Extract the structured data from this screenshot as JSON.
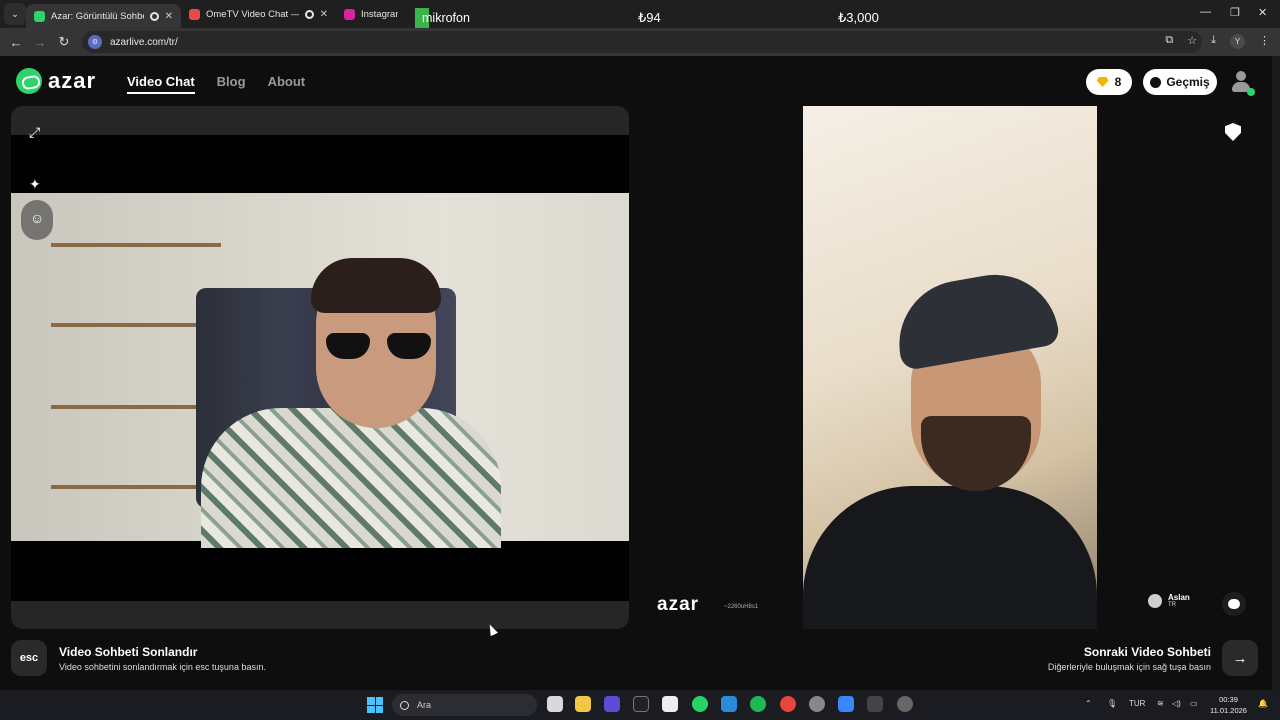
{
  "browser": {
    "tabs": [
      {
        "title": "Azar: Görüntülü Sohbet & Video",
        "color": "#2ed36a"
      },
      {
        "title": "OmeTV Video Chat — Omegle",
        "color": "#e64a4a"
      },
      {
        "title": "Instagram",
        "color": "#d6249f"
      }
    ],
    "overlay_label": "mikrofon",
    "overlay_value_1": "₺94",
    "overlay_value_2": "₺3,000",
    "url": "azarlive.com/tr/",
    "profile_letter": "Y"
  },
  "app": {
    "logo": "azar",
    "nav": {
      "video_chat": "Video Chat",
      "blog": "Blog",
      "about": "About"
    },
    "gems": "8",
    "history_label": "Geçmiş",
    "watermark": "azar",
    "watermark_id": "~2260uH8s1",
    "peer": {
      "name": "Aslan",
      "country": "TR"
    },
    "end": {
      "key": "esc",
      "title": "Video Sohbeti Sonlandır",
      "desc": "Video sohbetini sonlandırmak için esc tuşuna basın."
    },
    "next": {
      "title": "Sonraki Video Sohbeti",
      "desc": "Diğerleriyle buluşmak için sağ tuşa basın",
      "arrow": "→"
    }
  },
  "taskbar": {
    "search_placeholder": "Ara",
    "language": "TUR",
    "time": "00:39",
    "date": "11.01.2026"
  }
}
